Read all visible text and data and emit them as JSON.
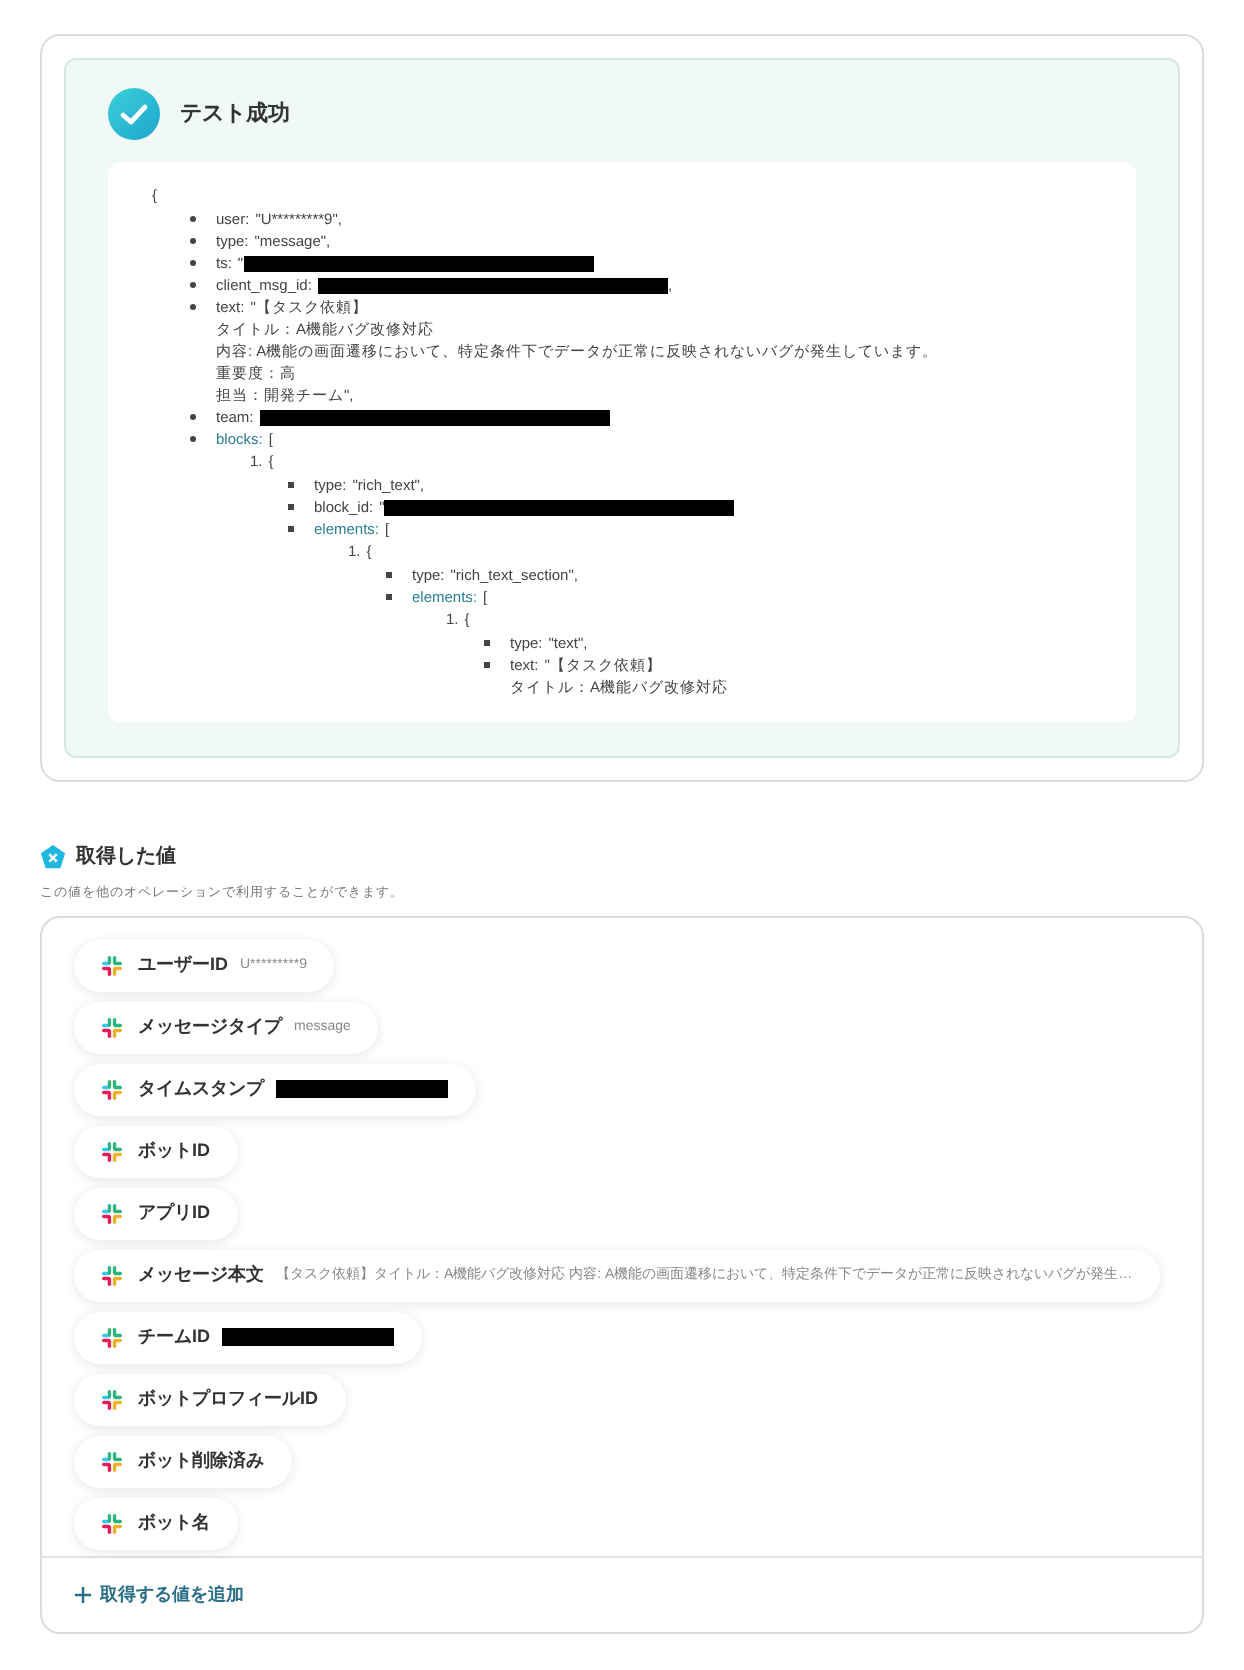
{
  "test_result": {
    "title": "テスト成功",
    "success": true,
    "code": {
      "open": "{",
      "fields": [
        {
          "kind": "value",
          "key": "user:",
          "lines": [
            "\"U*********9\","
          ]
        },
        {
          "kind": "value",
          "key": "type:",
          "lines": [
            "\"message\","
          ]
        },
        {
          "kind": "redacted",
          "key": "ts:",
          "before": "\""
        },
        {
          "kind": "redacted",
          "key": "client_msg_id:",
          "after": ","
        },
        {
          "kind": "value",
          "key": "text:",
          "lines": [
            "\"【タスク依頼】",
            "タイトル：A機能バグ改修対応",
            "内容: A機能の画面遷移において、特定条件下でデータが正常に反映されないバグが発生しています。",
            "重要度：高",
            "担当：開発チーム\","
          ]
        },
        {
          "kind": "redacted",
          "key": "team:"
        },
        {
          "kind": "array",
          "key": "blocks:",
          "open": "[",
          "items": [
            {
              "marker": "1.",
              "open": "{",
              "fields": [
                {
                  "kind": "value",
                  "key": "type:",
                  "lines": [
                    "\"rich_text\","
                  ]
                },
                {
                  "kind": "redacted",
                  "key": "block_id:",
                  "before": "\""
                },
                {
                  "kind": "array",
                  "key": "elements:",
                  "open": "[",
                  "items": [
                    {
                      "marker": "1.",
                      "open": "{",
                      "fields": [
                        {
                          "kind": "value",
                          "key": "type:",
                          "lines": [
                            "\"rich_text_section\","
                          ]
                        },
                        {
                          "kind": "array",
                          "key": "elements:",
                          "open": "[",
                          "items": [
                            {
                              "marker": "1.",
                              "open": "{",
                              "fields": [
                                {
                                  "kind": "value",
                                  "key": "type:",
                                  "lines": [
                                    "\"text\","
                                  ]
                                },
                                {
                                  "kind": "value",
                                  "key": "text:",
                                  "lines": [
                                    "\"【タスク依頼】",
                                    "タイトル：A機能バグ改修対応"
                                  ]
                                }
                              ]
                            }
                          ]
                        }
                      ]
                    }
                  ]
                }
              ]
            }
          ]
        }
      ]
    }
  },
  "retrieved_values": {
    "title": "取得した値",
    "description": "この値を他のオペレーションで利用することができます。",
    "items": [
      {
        "label": "ユーザーID",
        "value": "U*********9"
      },
      {
        "label": "メッセージタイプ",
        "value": "message"
      },
      {
        "label": "タイムスタンプ",
        "redacted": true
      },
      {
        "label": "ボットID"
      },
      {
        "label": "アプリID"
      },
      {
        "label": "メッセージ本文",
        "value": "【タスク依頼】タイトル：A機能バグ改修対応 内容: A機能の画面遷移において、特定条件下でデータが正常に反映されないバグが発生…"
      },
      {
        "label": "チームID",
        "redacted": true
      },
      {
        "label": "ボットプロフィールID"
      },
      {
        "label": "ボット削除済み"
      },
      {
        "label": "ボット名"
      }
    ],
    "add_button": "取得する値を追加"
  }
}
